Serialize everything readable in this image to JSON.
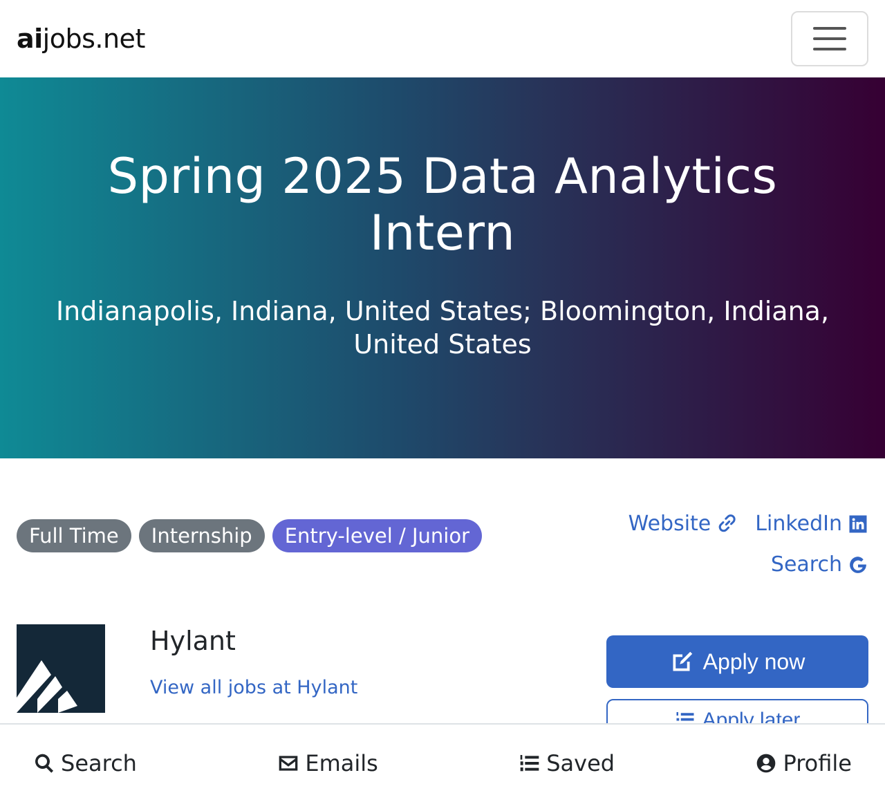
{
  "navbar": {
    "brand_bold": "ai",
    "brand_rest": "jobs.net",
    "menu_icon": "hamburger-icon"
  },
  "hero": {
    "title": "Spring 2025 Data Analytics Intern",
    "location": "Indianapolis, Indiana, United States; Bloomington, Indiana, United States",
    "gradient": [
      "#0f8a95",
      "#360033"
    ]
  },
  "badges": [
    {
      "label": "Full Time",
      "color": "#6c757d"
    },
    {
      "label": "Internship",
      "color": "#6c757d"
    },
    {
      "label": "Entry-level / Junior",
      "color": "#6366d4"
    }
  ],
  "links": {
    "website": {
      "label": "Website",
      "icon": "link-icon"
    },
    "linkedin": {
      "label": "LinkedIn",
      "icon": "linkedin-icon"
    },
    "search": {
      "label": "Search",
      "icon": "google-icon"
    }
  },
  "company": {
    "name": "Hylant",
    "view_all": "View all jobs at Hylant"
  },
  "actions": {
    "apply_now": "Apply now",
    "apply_later": "Apply later",
    "accent": "#3366c4"
  },
  "bottom_nav": [
    {
      "label": "Search",
      "icon": "search-icon"
    },
    {
      "label": "Emails",
      "icon": "envelope-icon"
    },
    {
      "label": "Saved",
      "icon": "numbered-list-icon"
    },
    {
      "label": "Profile",
      "icon": "user-circle-icon"
    }
  ]
}
